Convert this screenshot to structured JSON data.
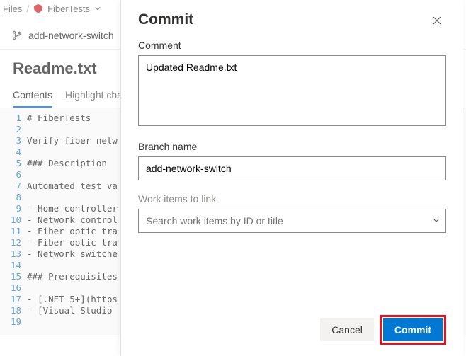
{
  "breadcrumb": {
    "files": "Files",
    "repo": "FiberTests"
  },
  "branch": {
    "name": "add-network-switch"
  },
  "file": {
    "title": "Readme.txt"
  },
  "tabs": {
    "contents": "Contents",
    "highlight": "Highlight cha"
  },
  "code_lines": [
    "# FiberTests",
    "",
    "Verify fiber netw",
    "",
    "### Description",
    "",
    "Automated test va",
    "",
    "- Home controller",
    "- Network control",
    "- Fiber optic tra",
    "- Fiber optic tra",
    "- Network switche",
    "",
    "### Prerequisites",
    "",
    "- [.NET 5+](https",
    "- [Visual Studio ",
    ""
  ],
  "modal": {
    "title": "Commit",
    "comment_label": "Comment",
    "comment_value": "Updated Readme.txt",
    "branch_label": "Branch name",
    "branch_value": "add-network-switch",
    "workitems_label": "Work items to link",
    "workitems_placeholder": "Search work items by ID or title",
    "cancel": "Cancel",
    "commit": "Commit"
  }
}
